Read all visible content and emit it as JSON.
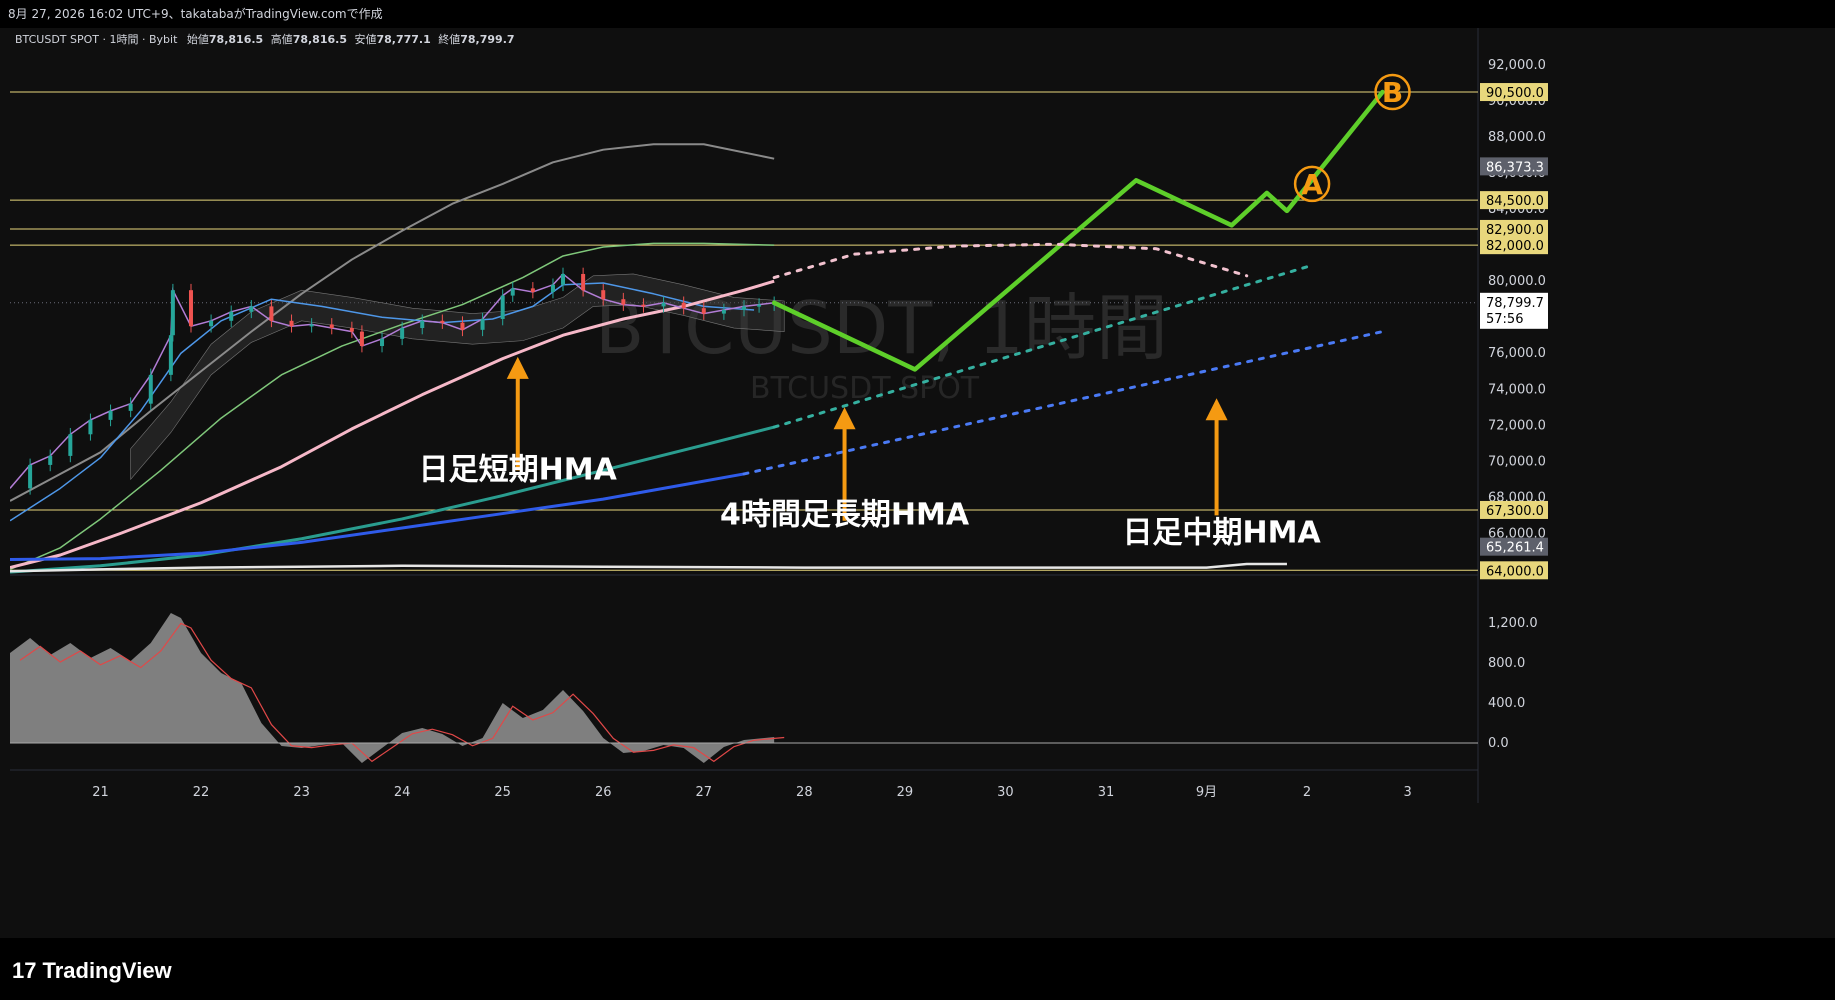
{
  "header": {
    "info": "8月 27, 2026 16:02 UTC+9、takatabaがTradingView.comで作成"
  },
  "legend": {
    "symbol": "BTCUSDT SPOT · 1時間 · Bybit",
    "open_label": "始値",
    "open": "78,816.5",
    "high_label": "高値",
    "high": "78,816.5",
    "low_label": "安値",
    "low": "78,777.1",
    "close_label": "終値",
    "close": "78,799.7"
  },
  "watermark": {
    "main": "BTCUSDT, 1時間",
    "sub": "BTCUSDT SPOT"
  },
  "annotations": [
    {
      "text": "日足短期HMA"
    },
    {
      "text": "4時間足長期HMA"
    },
    {
      "text": "日足中期HMA"
    }
  ],
  "markers": {
    "a": "A",
    "b": "B"
  },
  "colors": {
    "background": "#0f0f0f",
    "projection": "#5ecf2a",
    "arrow": "#f59a12",
    "hline": "#e8d77c",
    "hma_short": "#f6b8c8",
    "hma_4h": "#2a9d8f",
    "hma_mid": "#2f5bea",
    "oscillator": "#8c8c8c"
  },
  "chart_data": {
    "type": "line",
    "y_unit": "USDT",
    "ylim": [
      63800,
      93500
    ],
    "x_ticks": [
      "21",
      "22",
      "23",
      "24",
      "25",
      "26",
      "27",
      "28",
      "29",
      "30",
      "31",
      "9月",
      "2",
      "3"
    ],
    "y_ticks": [
      "92,000.0",
      "90,000.0",
      "88,000.0",
      "86,000.0",
      "84,000.0",
      "82,000.0",
      "80,000.0",
      "78,000.0",
      "76,000.0",
      "74,000.0",
      "72,000.0",
      "70,000.0",
      "68,000.0",
      "66,000.0",
      "64,000.0"
    ],
    "y_tick_values": [
      92000,
      90000,
      88000,
      86000,
      84000,
      82000,
      80000,
      78000,
      76000,
      74000,
      72000,
      70000,
      68000,
      66000,
      64000
    ],
    "horizontal_levels": [
      {
        "value": 90500,
        "label": "90,500.0"
      },
      {
        "value": 84500,
        "label": "84,500.0"
      },
      {
        "value": 82900,
        "label": "82,900.0"
      },
      {
        "value": 82000,
        "label": "82,000.0"
      },
      {
        "value": 67300,
        "label": "67,300.0"
      },
      {
        "value": 63950,
        "label": "64,000.0"
      }
    ],
    "price_badges": [
      {
        "value": 86373.3,
        "label": "86,373.3"
      },
      {
        "value": 65261.4,
        "label": "65,261.4"
      }
    ],
    "current_price": {
      "value": 78799.7,
      "label": "78,799.7",
      "countdown": "57:56"
    },
    "price_series": {
      "name": "BTCUSDT",
      "x": [
        20.1,
        20.3,
        20.5,
        20.7,
        20.9,
        21.1,
        21.3,
        21.5,
        21.7,
        21.72,
        21.9,
        22.1,
        22.3,
        22.5,
        22.7,
        22.9,
        23.1,
        23.3,
        23.5,
        23.6,
        23.8,
        24.0,
        24.2,
        24.4,
        24.6,
        24.8,
        25.0,
        25.1,
        25.3,
        25.5,
        25.6,
        25.8,
        26.0,
        26.2,
        26.4,
        26.6,
        26.8,
        27.0,
        27.2,
        27.4,
        27.55,
        27.7
      ],
      "values": [
        68500,
        69800,
        70300,
        71500,
        72300,
        72800,
        73200,
        74800,
        77000,
        79500,
        77500,
        77800,
        78300,
        78600,
        77800,
        77500,
        77600,
        77400,
        77200,
        76400,
        76800,
        77400,
        77800,
        77700,
        77300,
        77900,
        79200,
        79600,
        79400,
        79800,
        80400,
        79500,
        79000,
        78700,
        78600,
        78800,
        78500,
        78200,
        78400,
        78600,
        78700,
        78800
      ]
    },
    "series": [
      {
        "name": "",
        "x": [
          20.1,
          20.5,
          21.0,
          21.5,
          22.0,
          22.5,
          23.0,
          23.5,
          24.0,
          24.5,
          25.0,
          25.5,
          26.0,
          26.5,
          27.0,
          27.7
        ],
        "values": [
          67800,
          69000,
          70500,
          72800,
          75000,
          77200,
          79300,
          81200,
          82800,
          84300,
          85400,
          86600,
          87300,
          87600,
          87600,
          86800
        ]
      },
      {
        "name": "",
        "x": [
          20.1,
          20.6,
          21.0,
          21.6,
          22.2,
          22.8,
          23.4,
          24.0,
          24.6,
          25.2,
          25.6,
          26.0,
          26.5,
          27.0,
          27.7
        ],
        "values": [
          64000,
          65200,
          66800,
          69500,
          72400,
          74800,
          76400,
          77600,
          78700,
          80200,
          81400,
          81900,
          82100,
          82100,
          82000
        ]
      },
      {
        "name": "",
        "x": [
          20.1,
          20.6,
          21.0,
          21.4,
          21.8,
          22.2,
          22.7,
          23.2,
          23.8,
          24.4,
          24.9,
          25.3,
          25.6,
          26.0,
          26.5,
          27.0,
          27.5
        ],
        "values": [
          66700,
          68500,
          70200,
          72800,
          76000,
          77800,
          79000,
          78600,
          78000,
          77700,
          77900,
          78600,
          79800,
          79900,
          79300,
          78600,
          78400
        ]
      },
      {
        "name": "日足短期HMA",
        "x": [
          20.1,
          20.6,
          21.2,
          22.0,
          22.8,
          23.5,
          24.2,
          25.0,
          25.6,
          26.2,
          26.8,
          27.4,
          27.7
        ],
        "values": [
          64100,
          64800,
          66000,
          67700,
          69700,
          71800,
          73700,
          75700,
          77000,
          77900,
          78600,
          79500,
          80000
        ]
      },
      {
        "name": "4時間足長期HMA",
        "x": [
          20.1,
          21.0,
          22.0,
          23.0,
          24.0,
          25.0,
          26.0,
          27.0,
          27.7
        ],
        "values": [
          63850,
          64200,
          64800,
          65700,
          66800,
          68100,
          69500,
          70900,
          71900
        ]
      },
      {
        "name": "日足中期HMA",
        "x": [
          20.1,
          21.0,
          22.0,
          23.0,
          24.0,
          25.0,
          26.0,
          26.8,
          27.4
        ],
        "values": [
          64550,
          64600,
          64900,
          65500,
          66300,
          67100,
          67900,
          68700,
          69300
        ]
      },
      {
        "name": "",
        "x": [
          20.1,
          21.0,
          22.0,
          23.0,
          24.0,
          26.0,
          28.0,
          30.0,
          32.0,
          32.4,
          32.8
        ],
        "values": [
          63900,
          64000,
          64100,
          64150,
          64200,
          64150,
          64100,
          64100,
          64100,
          64300,
          64300
        ]
      }
    ],
    "projections": [
      {
        "name": "",
        "x": [
          27.7,
          29.1,
          31.3,
          32.25,
          32.6,
          32.8,
          33.75
        ],
        "values": [
          78800,
          75100,
          85600,
          83100,
          84900,
          83900,
          90500
        ]
      },
      {
        "name": "",
        "x": [
          27.7,
          28.5,
          29.5,
          30.5,
          31.5,
          32.4
        ],
        "values": [
          80200,
          81500,
          81950,
          82050,
          81800,
          80300
        ]
      },
      {
        "name": "",
        "x": [
          27.7,
          33.0
        ],
        "values": [
          71900,
          80800
        ]
      },
      {
        "name": "",
        "x": [
          27.4,
          33.75
        ],
        "values": [
          69300,
          77200
        ]
      }
    ],
    "arrows": [
      {
        "x": 25.15,
        "from": 69500,
        "to": 75800
      },
      {
        "x": 28.4,
        "from": 66700,
        "to": 73000
      },
      {
        "x": 32.1,
        "from": 67000,
        "to": 73500
      }
    ],
    "annotation_positions": [
      {
        "x": 25.15,
        "y": 69000
      },
      {
        "x": 28.4,
        "y": 66500
      },
      {
        "x": 32.15,
        "y": 65500
      }
    ],
    "marker_positions": [
      {
        "label": "A",
        "x": 33.05,
        "y": 85400
      },
      {
        "label": "B",
        "x": 33.85,
        "y": 90500
      }
    ],
    "oscillator": {
      "ylim": [
        -250,
        1550
      ],
      "y_ticks": [
        "1,200.0",
        "800.0",
        "400.0",
        "0.0"
      ],
      "y_tick_values": [
        1200,
        800,
        400,
        0
      ],
      "x": [
        20.1,
        20.3,
        20.5,
        20.7,
        20.9,
        21.1,
        21.3,
        21.5,
        21.7,
        21.8,
        22.0,
        22.2,
        22.4,
        22.6,
        22.8,
        23.0,
        23.2,
        23.4,
        23.6,
        23.8,
        24.0,
        24.2,
        24.4,
        24.6,
        24.8,
        25.0,
        25.2,
        25.4,
        25.6,
        25.8,
        26.0,
        26.2,
        26.4,
        26.6,
        26.8,
        27.0,
        27.2,
        27.4,
        27.7
      ],
      "values": [
        900,
        1050,
        880,
        1000,
        850,
        950,
        820,
        1000,
        1300,
        1250,
        900,
        700,
        600,
        200,
        -30,
        -50,
        -20,
        0,
        -200,
        -50,
        100,
        150,
        90,
        -30,
        50,
        400,
        250,
        330,
        530,
        320,
        50,
        -100,
        -80,
        -20,
        -50,
        -200,
        -40,
        30,
        60
      ]
    }
  }
}
